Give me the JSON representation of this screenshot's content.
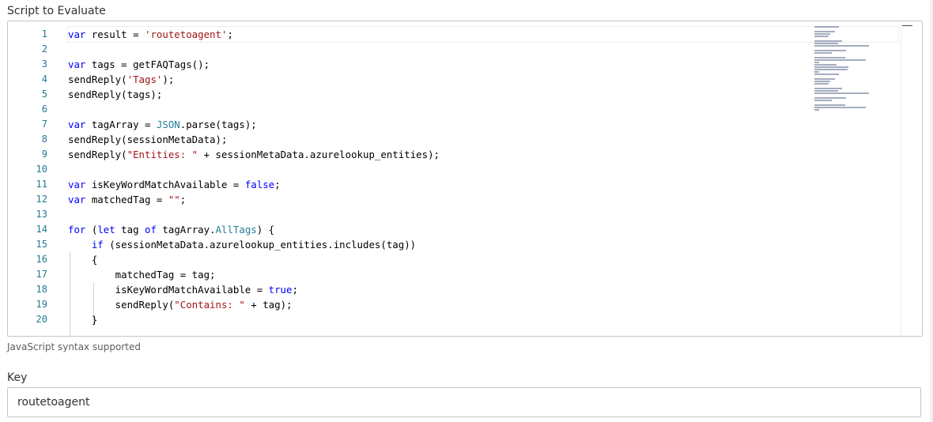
{
  "script_field": {
    "label": "Script to Evaluate",
    "hint": "JavaScript syntax supported",
    "line_numbers": [
      "1",
      "2",
      "3",
      "4",
      "5",
      "6",
      "7",
      "8",
      "9",
      "10",
      "11",
      "12",
      "13",
      "14",
      "15",
      "16",
      "17",
      "18",
      "19",
      "20"
    ],
    "lines": [
      [
        {
          "t": "var",
          "c": "kw"
        },
        {
          "t": " result = "
        },
        {
          "t": "'routetoagent'",
          "c": "str"
        },
        {
          "t": ";"
        }
      ],
      [],
      [
        {
          "t": "var",
          "c": "kw"
        },
        {
          "t": " tags = getFAQTags();"
        }
      ],
      [
        {
          "t": "sendReply("
        },
        {
          "t": "'Tags'",
          "c": "str"
        },
        {
          "t": ");"
        }
      ],
      [
        {
          "t": "sendReply(tags);"
        }
      ],
      [],
      [
        {
          "t": "var",
          "c": "kw"
        },
        {
          "t": " tagArray = "
        },
        {
          "t": "JSON",
          "c": "obj"
        },
        {
          "t": ".parse(tags);"
        }
      ],
      [
        {
          "t": "sendReply(sessionMetaData);"
        }
      ],
      [
        {
          "t": "sendReply("
        },
        {
          "t": "\"Entities: \"",
          "c": "str"
        },
        {
          "t": " + sessionMetaData.azurelookup_entities);"
        }
      ],
      [],
      [
        {
          "t": "var",
          "c": "kw"
        },
        {
          "t": " isKeyWordMatchAvailable = "
        },
        {
          "t": "false",
          "c": "kw"
        },
        {
          "t": ";"
        }
      ],
      [
        {
          "t": "var",
          "c": "kw"
        },
        {
          "t": " matchedTag = "
        },
        {
          "t": "\"\"",
          "c": "str"
        },
        {
          "t": ";"
        }
      ],
      [],
      [
        {
          "t": "for",
          "c": "kw"
        },
        {
          "t": " ("
        },
        {
          "t": "let",
          "c": "kw"
        },
        {
          "t": " tag "
        },
        {
          "t": "of",
          "c": "kw"
        },
        {
          "t": " tagArray."
        },
        {
          "t": "AllTags",
          "c": "obj"
        },
        {
          "t": ") {"
        }
      ],
      [
        {
          "t": "    "
        },
        {
          "t": "if",
          "c": "kw"
        },
        {
          "t": " (sessionMetaData.azurelookup_entities.includes(tag))"
        }
      ],
      [
        {
          "t": "    {"
        }
      ],
      [
        {
          "t": "        matchedTag = tag;"
        }
      ],
      [
        {
          "t": "        isKeyWordMatchAvailable = "
        },
        {
          "t": "true",
          "c": "kw"
        },
        {
          "t": ";"
        }
      ],
      [
        {
          "t": "        sendReply("
        },
        {
          "t": "\"Contains: \"",
          "c": "str"
        },
        {
          "t": " + tag);"
        }
      ],
      [
        {
          "t": "    }"
        }
      ]
    ]
  },
  "key_field": {
    "label": "Key",
    "value": "routetoagent"
  }
}
